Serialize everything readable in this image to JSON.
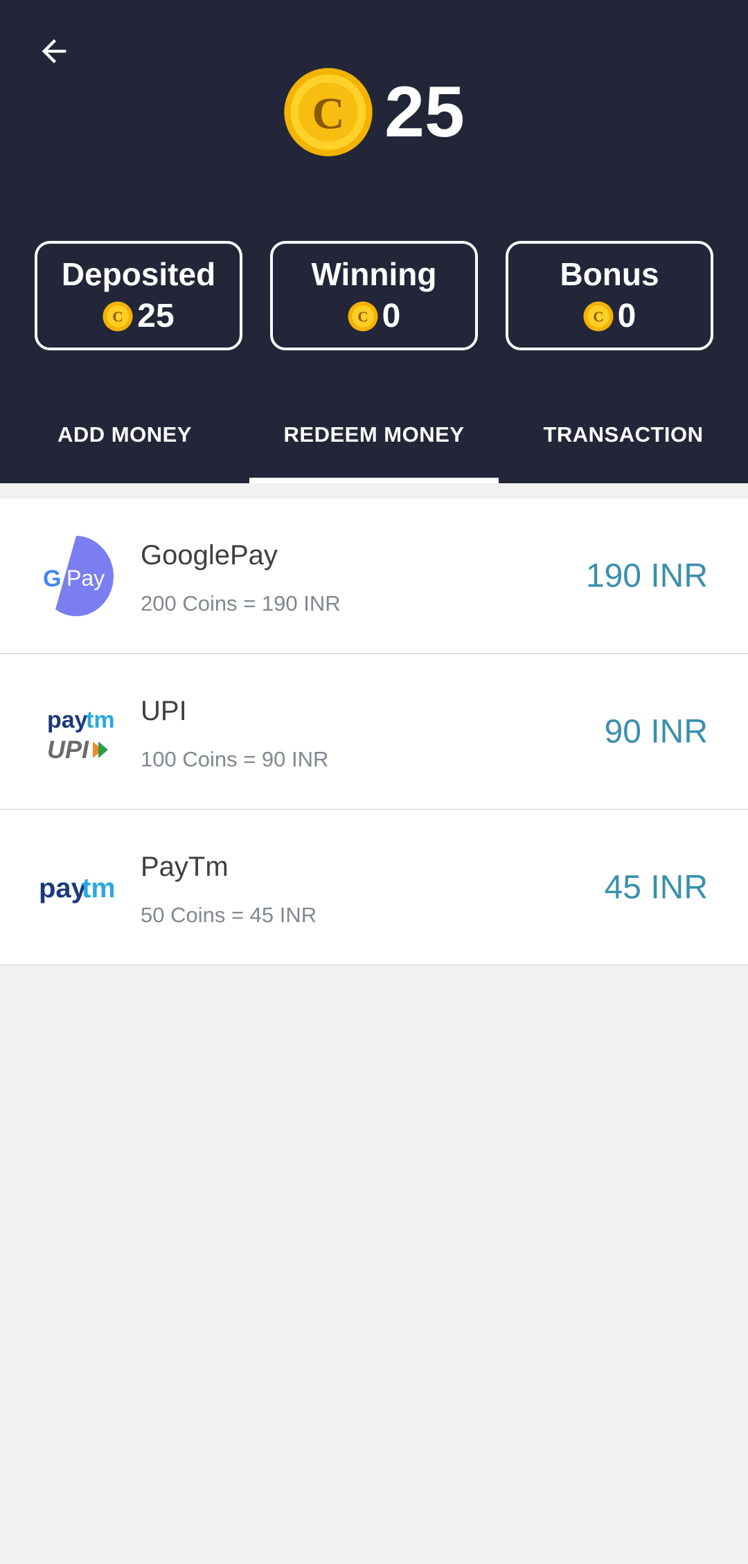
{
  "header": {
    "balance": "25",
    "icons": {
      "back": "back-arrow-icon",
      "coin": "coin-icon"
    },
    "colors": {
      "background": "#232638",
      "coin": "#f5b800"
    }
  },
  "wallets": [
    {
      "title": "Deposited",
      "value": "25"
    },
    {
      "title": "Winning",
      "value": "0"
    },
    {
      "title": "Bonus",
      "value": "0"
    }
  ],
  "tabs": [
    {
      "label": "ADD MONEY",
      "active": false
    },
    {
      "label": "REDEEM MONEY",
      "active": true
    },
    {
      "label": "TRANSACTION",
      "active": false
    }
  ],
  "redeem_options": [
    {
      "name": "GooglePay",
      "rate": "200 Coins = 190 INR",
      "amount": "190 INR",
      "logo": "google-pay-logo",
      "logo_text": "Pay"
    },
    {
      "name": "UPI",
      "rate": "100 Coins = 90 INR",
      "amount": "90 INR",
      "logo": "paytm-upi-logo",
      "logo_text": "paytm UPI"
    },
    {
      "name": "PayTm",
      "rate": "50 Coins = 45 INR",
      "amount": "45 INR",
      "logo": "paytm-logo",
      "logo_text": "paytm"
    }
  ],
  "colors": {
    "amount": "#3a8fae",
    "page_background": "#f1f1f1"
  }
}
